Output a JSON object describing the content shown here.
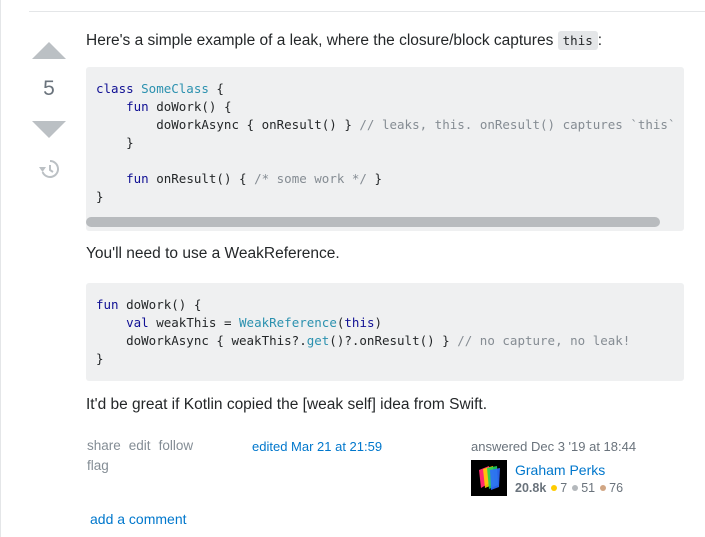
{
  "vote": {
    "count": "5"
  },
  "answer": {
    "intro_text": "Here's a simple example of a leak, where the closure/block captures ",
    "intro_code": "this",
    "intro_suffix": ":",
    "code1": {
      "lines": [
        [
          "class ",
          "SomeClass",
          " {"
        ],
        [
          "    fun ",
          "doWork() {"
        ],
        [
          "        doWorkAsync { onResult() } ",
          "// leaks, this. onResult() captures `this`"
        ],
        [
          "    }"
        ],
        [
          ""
        ],
        [
          "    fun ",
          "onResult() { ",
          "/* some work */",
          " }"
        ],
        [
          "}"
        ]
      ]
    },
    "middle_text": "You'll need to use a WeakReference.",
    "code2": {
      "lines": [
        [
          "fun ",
          "doWork() {"
        ],
        [
          "    val ",
          "weakThis = ",
          "WeakReference",
          "(",
          "this",
          ")"
        ],
        [
          "    doWorkAsync { weakThis?.",
          "get",
          "()?.onResult() } ",
          "// no capture, no leak!"
        ],
        [
          "}"
        ]
      ]
    },
    "closing_text": "It'd be great if Kotlin copied the [weak self] idea from Swift."
  },
  "menu": {
    "share": "share",
    "edit": "edit",
    "follow": "follow",
    "flag": "flag"
  },
  "edited": "edited Mar 21 at 21:59",
  "signature": {
    "answered": "answered Dec 3 '19 at 18:44",
    "user": "Graham Perks",
    "reputation": "20.8k",
    "gold": "7",
    "silver": "51",
    "bronze": "76",
    "colors": {
      "gold": "#ffcc01",
      "silver": "#b4b8bc",
      "bronze": "#d1a684"
    }
  },
  "add_comment": "add a comment"
}
